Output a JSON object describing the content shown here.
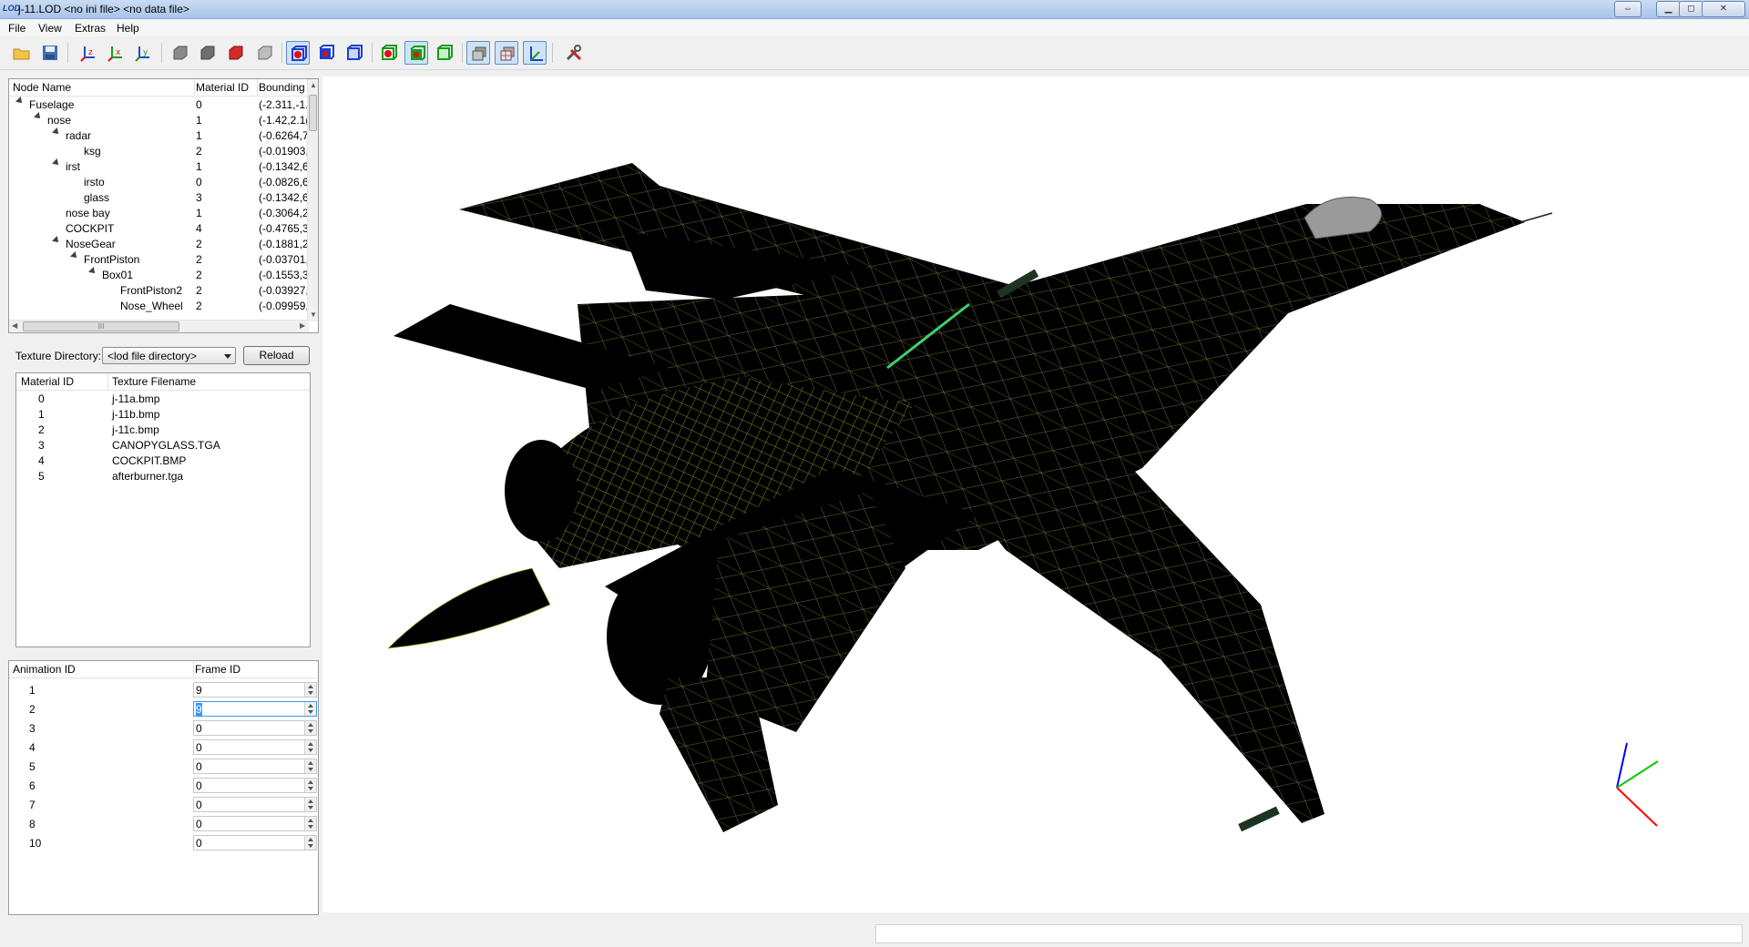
{
  "window": {
    "logo": "LOD",
    "title": "j-11.LOD  <no ini file>  <no data file>",
    "controls": [
      "restore-icon",
      "minimize-icon",
      "maximize-icon",
      "close-icon"
    ]
  },
  "menu": [
    "File",
    "View",
    "Extras",
    "Help"
  ],
  "toolbar": {
    "buttons": [
      {
        "name": "open-icon"
      },
      {
        "name": "save-icon"
      },
      {
        "name": "axis-z-icon"
      },
      {
        "name": "axis-x-icon"
      },
      {
        "name": "axis-y-icon"
      },
      {
        "name": "shade-gray-icon"
      },
      {
        "name": "shade-flat-icon"
      },
      {
        "name": "shade-red-icon"
      },
      {
        "name": "shade-light-icon"
      },
      {
        "name": "blue-cube-wire-icon",
        "checked": true
      },
      {
        "name": "blue-cube-solid-icon"
      },
      {
        "name": "blue-cube-outline-icon"
      },
      {
        "name": "green-cube-wire-icon"
      },
      {
        "name": "green-cube-solid-icon",
        "checked": true
      },
      {
        "name": "green-cube-outline-icon"
      },
      {
        "name": "stack-icon",
        "checked": true
      },
      {
        "name": "stack-grid-icon",
        "checked": true
      },
      {
        "name": "axes-icon",
        "checked": true
      },
      {
        "name": "tools-icon"
      }
    ]
  },
  "node_tree": {
    "headers": [
      "Node Name",
      "Material ID",
      "Bounding"
    ],
    "rows": [
      {
        "name": "Fuselage",
        "depth": 0,
        "expanded": true,
        "mat": "0",
        "bbox": "(-2.311,-1."
      },
      {
        "name": "nose",
        "depth": 1,
        "expanded": true,
        "mat": "1",
        "bbox": "(-1.42,2.1("
      },
      {
        "name": "radar",
        "depth": 2,
        "expanded": true,
        "mat": "1",
        "bbox": "(-0.6264,7"
      },
      {
        "name": "ksg",
        "depth": 3,
        "expanded": false,
        "mat": "2",
        "bbox": "(-0.01903,"
      },
      {
        "name": "irst",
        "depth": 2,
        "expanded": true,
        "mat": "1",
        "bbox": "(-0.1342,6"
      },
      {
        "name": "irsto",
        "depth": 3,
        "expanded": false,
        "mat": "0",
        "bbox": "(-0.0826,6"
      },
      {
        "name": "glass",
        "depth": 3,
        "expanded": false,
        "mat": "3",
        "bbox": "(-0.1342,6"
      },
      {
        "name": "nose bay",
        "depth": 2,
        "expanded": false,
        "mat": "1",
        "bbox": "(-0.3064,2"
      },
      {
        "name": "COCKPIT",
        "depth": 2,
        "expanded": false,
        "mat": "4",
        "bbox": "(-0.4765,3"
      },
      {
        "name": "NoseGear",
        "depth": 2,
        "expanded": true,
        "mat": "2",
        "bbox": "(-0.1881,2"
      },
      {
        "name": "FrontPiston",
        "depth": 3,
        "expanded": true,
        "mat": "2",
        "bbox": "(-0.03701,"
      },
      {
        "name": "Box01",
        "depth": 4,
        "expanded": true,
        "mat": "2",
        "bbox": "(-0.1553,3"
      },
      {
        "name": "FrontPiston2",
        "depth": 5,
        "expanded": false,
        "mat": "2",
        "bbox": "(-0.03927,"
      },
      {
        "name": "Nose_Wheel",
        "depth": 5,
        "expanded": false,
        "mat": "2",
        "bbox": "(-0.09959,"
      }
    ],
    "hscroll_glyph": "III"
  },
  "texture_dir": {
    "label": "Texture Directory:",
    "value": "<lod file directory>",
    "reload": "Reload"
  },
  "materials": {
    "headers": [
      "Material ID",
      "Texture Filename"
    ],
    "rows": [
      {
        "id": "0",
        "file": "j-11a.bmp"
      },
      {
        "id": "1",
        "file": "j-11b.bmp"
      },
      {
        "id": "2",
        "file": "j-11c.bmp"
      },
      {
        "id": "3",
        "file": "CANOPYGLASS.TGA"
      },
      {
        "id": "4",
        "file": "COCKPIT.BMP"
      },
      {
        "id": "5",
        "file": "afterburner.tga"
      }
    ]
  },
  "animations": {
    "headers": [
      "Animation ID",
      "Frame ID"
    ],
    "rows": [
      {
        "id": "1",
        "frame": "9"
      },
      {
        "id": "2",
        "frame": "9",
        "focused": true
      },
      {
        "id": "3",
        "frame": "0"
      },
      {
        "id": "4",
        "frame": "0"
      },
      {
        "id": "5",
        "frame": "0"
      },
      {
        "id": "6",
        "frame": "0"
      },
      {
        "id": "7",
        "frame": "0"
      },
      {
        "id": "8",
        "frame": "0"
      },
      {
        "id": "10",
        "frame": "0"
      }
    ]
  },
  "viewport": {
    "background": "#ffffff",
    "model_fill": "#000000",
    "wire_color": "#c8c040",
    "axis_colors": {
      "x": "#ff0000",
      "y": "#00cc00",
      "z": "#0000ff"
    }
  },
  "status": {
    "text": ""
  }
}
